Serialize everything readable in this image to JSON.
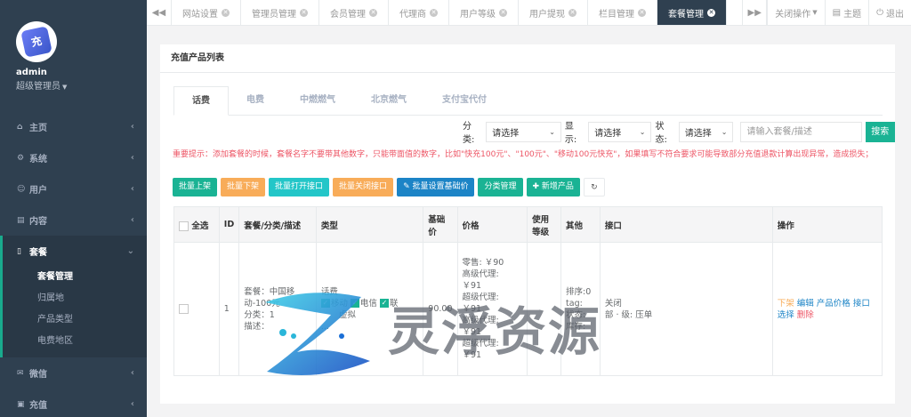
{
  "sidebar": {
    "username": "admin",
    "role": "超级管理员",
    "menu": [
      {
        "icon": "home-icon",
        "glyph": "⌂",
        "label": "主页"
      },
      {
        "icon": "gears-icon",
        "glyph": "⚙",
        "label": "系统"
      },
      {
        "icon": "users-icon",
        "glyph": "☺",
        "label": "用户"
      },
      {
        "icon": "book-icon",
        "glyph": "▤",
        "label": "内容"
      },
      {
        "icon": "file-icon",
        "glyph": "▯",
        "label": "套餐",
        "active": true
      },
      {
        "icon": "wechat-icon",
        "glyph": "✉",
        "label": "微信"
      },
      {
        "icon": "recharge-icon",
        "glyph": "▣",
        "label": "充值"
      }
    ],
    "submenu": [
      "套餐管理",
      "归属地",
      "产品类型",
      "电费地区"
    ]
  },
  "topbar": {
    "tabs": [
      "网站设置",
      "管理员管理",
      "会员管理",
      "代理商",
      "用户等级",
      "用户提现",
      "栏目管理",
      "套餐管理"
    ],
    "close_ops": "关闭操作",
    "theme": "主题",
    "logout": "退出"
  },
  "panel": {
    "title": "充值产品列表",
    "subtabs": [
      "话费",
      "电费",
      "中燃燃气",
      "北京燃气",
      "支付宝代付"
    ],
    "filters": {
      "category_label": "分类:",
      "display_label": "显示:",
      "status_label": "状态:",
      "select_placeholder": "请选择",
      "search_placeholder": "请输入套餐/描述",
      "search_button": "搜索"
    },
    "notice": "重要提示：添加套餐的时候，套餐名字不要带其他数字，只能带面值的数字，比如\"快充100元\"、\"100元\"、\"移动100元快充\"，如果填写不符合要求可能导致部分充值退款计算出现异常，造成损失；",
    "actions": [
      "批量上架",
      "批量下架",
      "批量打开接口",
      "批量关闭接口",
      "批量设置基础价",
      "分类管理",
      "新增产品"
    ],
    "table": {
      "headers": [
        "全选",
        "ID",
        "套餐/分类/描述",
        "类型",
        "基础价",
        "价格",
        "使用等级",
        "其他",
        "接口",
        "操作"
      ],
      "row": {
        "id": "1",
        "pkg_lines": [
          "套餐：中国移",
          "动-100元",
          "分类：1",
          "描述："
        ],
        "type_title": "话费",
        "type_checks": [
          "移动",
          "电信",
          "联"
        ],
        "type_extra": [
          "虚拟",
          "..."
        ],
        "base_price": "90.00",
        "price_lines": [
          "零售: ￥90",
          "高级代理:",
          "￥91",
          "超级代理:",
          "￥91",
          "高级代理:",
          "￥91",
          "超级代理:",
          "￥91"
        ],
        "level": "",
        "other_lines": [
          "排序:0",
          "tag:",
          "状态:",
          "库存:"
        ],
        "interface_lines": [
          "关闭",
          "部 · 级: 压单"
        ],
        "ops": {
          "off": "下架",
          "edit": "编辑",
          "price": "产品价格",
          "iface": "接口选择",
          "del": "删除"
        }
      }
    }
  },
  "watermark": {
    "text": "灵浮资源"
  }
}
